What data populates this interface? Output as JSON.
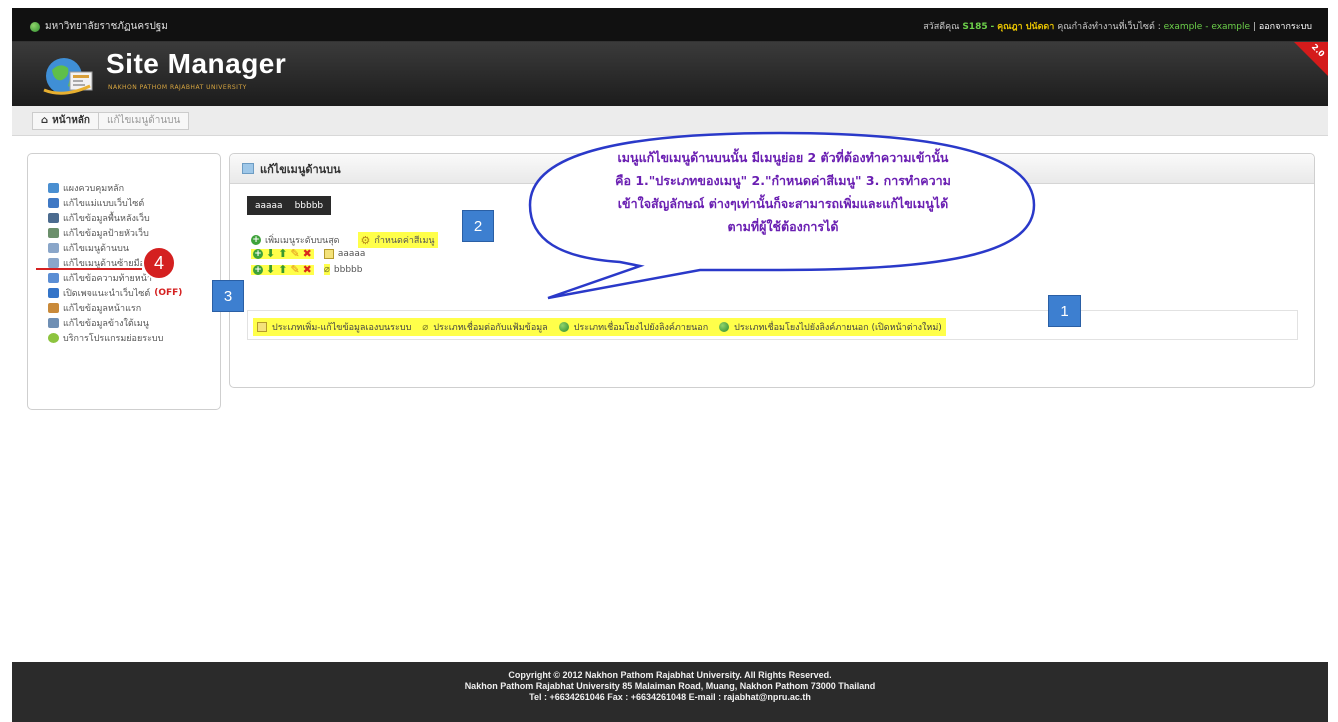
{
  "topbar": {
    "university": "มหาวิทยาลัยราชภัฏนครปฐม",
    "greeting": "สวัสดีคุณ",
    "user_id": "S185",
    "user_name": "คุณฎา ปนัดดา",
    "working_site_label": "คุณกำลังทำงานที่เว็บไซต์ :",
    "working_site": "example - example",
    "separator": "|",
    "logout": "ออกจากระบบ"
  },
  "banner": {
    "title": "Site Manager",
    "subtitle": "NAKHON PATHOM RAJABHAT UNIVERSITY",
    "version": "2.0"
  },
  "breadcrumb": {
    "home": "หน้าหลัก",
    "current": "แก้ไขเมนูด้านบน"
  },
  "sidebar": {
    "items": [
      {
        "label": "แผงควบคุมหลัก",
        "icon": "dashboard-icon",
        "color": "#4a8fd1"
      },
      {
        "label": "แก้ไขแม่แบบเว็บไซต์",
        "icon": "template-icon",
        "color": "#3f78c4"
      },
      {
        "label": "แก้ไขข้อมูลพื้นหลังเว็บ",
        "icon": "background-icon",
        "color": "#4b6b8f"
      },
      {
        "label": "แก้ไขข้อมูลป้ายหัวเว็บ",
        "icon": "header-icon",
        "color": "#6b8f6b"
      },
      {
        "label": "แก้ไขเมนูด้านบน",
        "icon": "top-menu-icon",
        "color": "#8aa6c9"
      },
      {
        "label": "แก้ไขเมนูด้านซ้ายมือ",
        "icon": "left-menu-icon",
        "color": "#8aa6c9"
      },
      {
        "label": "แก้ไขข้อความท้ายหน้า",
        "icon": "footer-text-icon",
        "color": "#5b8ed4"
      },
      {
        "label": "เปิดเพจแนะนำเว็บไซต์",
        "icon": "intro-page-icon",
        "color": "#3474c8",
        "status": "(OFF)"
      },
      {
        "label": "แก้ไขข้อมูลหน้าแรก",
        "icon": "home-page-icon",
        "color": "#c98a3a"
      },
      {
        "label": "แก้ไขข้อมูลข้างใต้เมนู",
        "icon": "below-menu-icon",
        "color": "#6f8fb4"
      },
      {
        "label": "บริการโปรแกรมย่อยระบบ",
        "icon": "subprogram-icon",
        "color": "#8dc43f"
      }
    ]
  },
  "panel": {
    "title": "แก้ไขเมนูด้านบน",
    "menu_preview": [
      "aaaaa",
      "bbbbb"
    ],
    "add_top_menu": "เพิ่มเมนูระดับบนสุด",
    "set_menu_color": "กำหนดค่าสีเมนู",
    "rows": [
      {
        "label": "aaaaa",
        "type_icon": "internal-page-icon"
      },
      {
        "label": "bbbbb",
        "type_icon": "attachment-icon"
      }
    ],
    "legend": [
      {
        "icon": "internal-page-icon",
        "label": "ประเภทเพิ่ม-แก้ไขข้อมูลเองบนระบบ"
      },
      {
        "icon": "attachment-icon",
        "label": "ประเภทเชื่อมต่อกับแฟ้มข้อมูล"
      },
      {
        "icon": "external-link-icon",
        "label": "ประเภทเชื่อมโยงไปยังลิงค์ภายนอก"
      },
      {
        "icon": "external-link-new-window-icon",
        "label": "ประเภทเชื่อมโยงไปยังลิงค์ภายนอก (เปิดหน้าต่างใหม่)"
      }
    ]
  },
  "annotations": {
    "badge1": "1",
    "badge2": "2",
    "badge3": "3",
    "badge4": "4",
    "bubble_lines": [
      "เมนูแก้ไขเมนูด้านบนนั้น มีเมนูย่อย 2 ตัวที่ต้องทำความเข้านั้น",
      "คือ 1.\"ประเภทของเมนู\" 2.\"กำหนดค่าสีเมนู\" 3. การทำความ",
      "เข้าใจสัญลักษณ์ ต่างๆเท่านั้นก็จะสามารถเพิ่มและแก้ไขเมนูได้",
      "ตามที่ผู้ใช้ต้องการได้"
    ]
  },
  "footer": {
    "line1": "Copyright © 2012 Nakhon Pathom Rajabhat University. All Rights Reserved.",
    "line2": "Nakhon Pathom Rajabhat University 85 Malaiman Road, Muang, Nakhon Pathom 73000 Thailand",
    "line3": "Tel : +6634261046 Fax : +6634261048 E-mail : rajabhat@npru.ac.th"
  }
}
